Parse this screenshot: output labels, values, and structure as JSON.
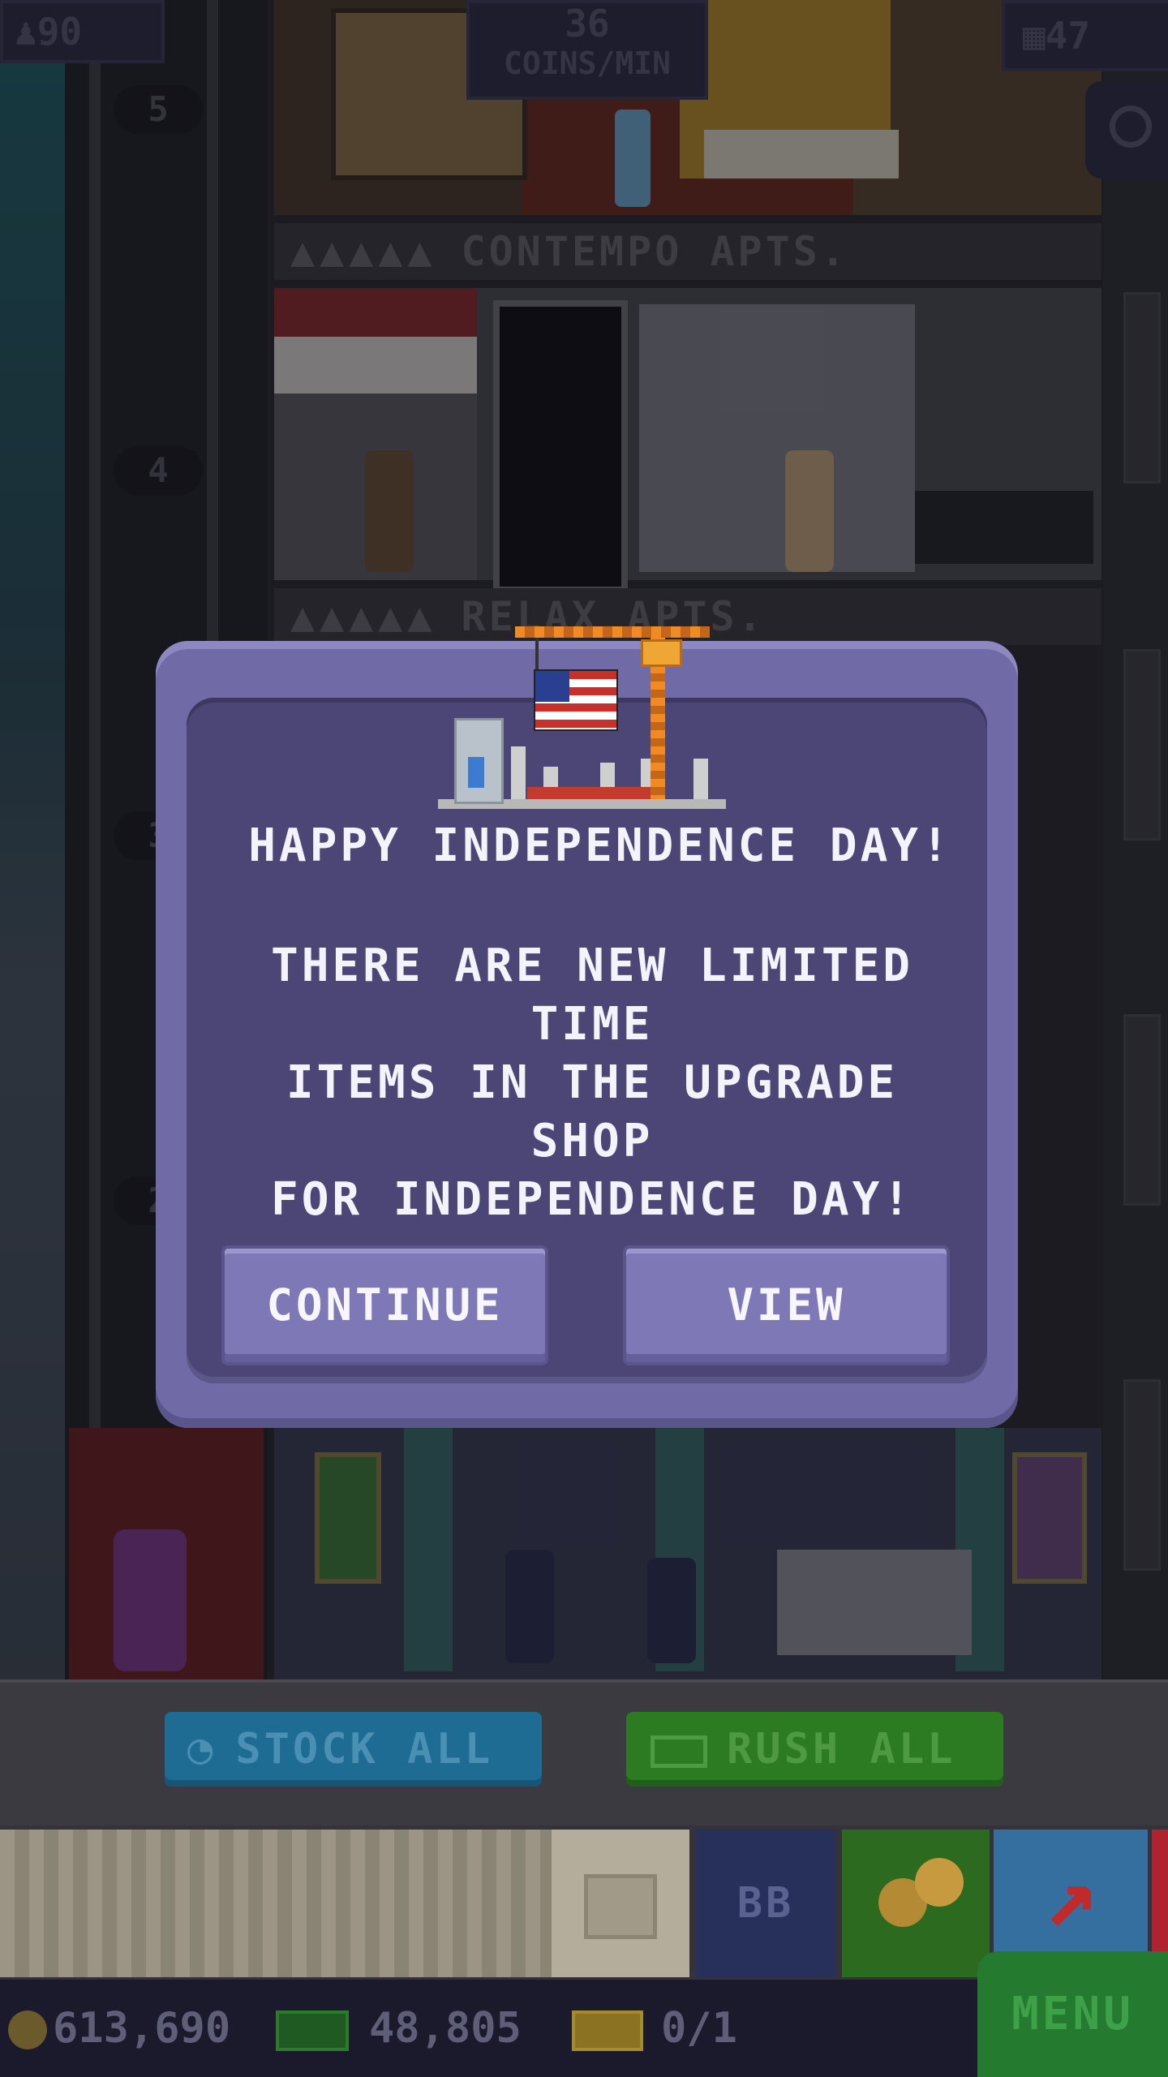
{
  "hud": {
    "population": "90",
    "rate_value": "36",
    "rate_unit": "COINS/MIN",
    "floors": "47"
  },
  "tower": {
    "floor_numbers": [
      "5",
      "4",
      "3",
      "2"
    ],
    "signs": [
      {
        "name": "CONTEMPO APTS."
      },
      {
        "name": "RELAX APTS."
      }
    ]
  },
  "dialog": {
    "title": "HAPPY INDEPENDENCE DAY!",
    "message_lines": [
      "THERE ARE NEW LIMITED TIME",
      "ITEMS IN THE UPGRADE SHOP",
      "FOR INDEPENDENCE DAY!"
    ],
    "continue_label": "CONTINUE",
    "view_label": "VIEW"
  },
  "actions": {
    "stock_all_label": "STOCK ALL",
    "rush_all_label": "RUSH ALL"
  },
  "dock": {
    "bb_label": "BB"
  },
  "status": {
    "coins": "613,690",
    "bux": "48,805",
    "tickets": "0/1",
    "menu_label": "MENU"
  },
  "colors": {
    "dialog_outer": "#706aa6",
    "dialog_inner": "#4b4676",
    "dialog_button": "#7e78b7",
    "stock_button": "#1e6b94",
    "rush_button": "#2c7a22",
    "menu_button": "#247a2f"
  }
}
